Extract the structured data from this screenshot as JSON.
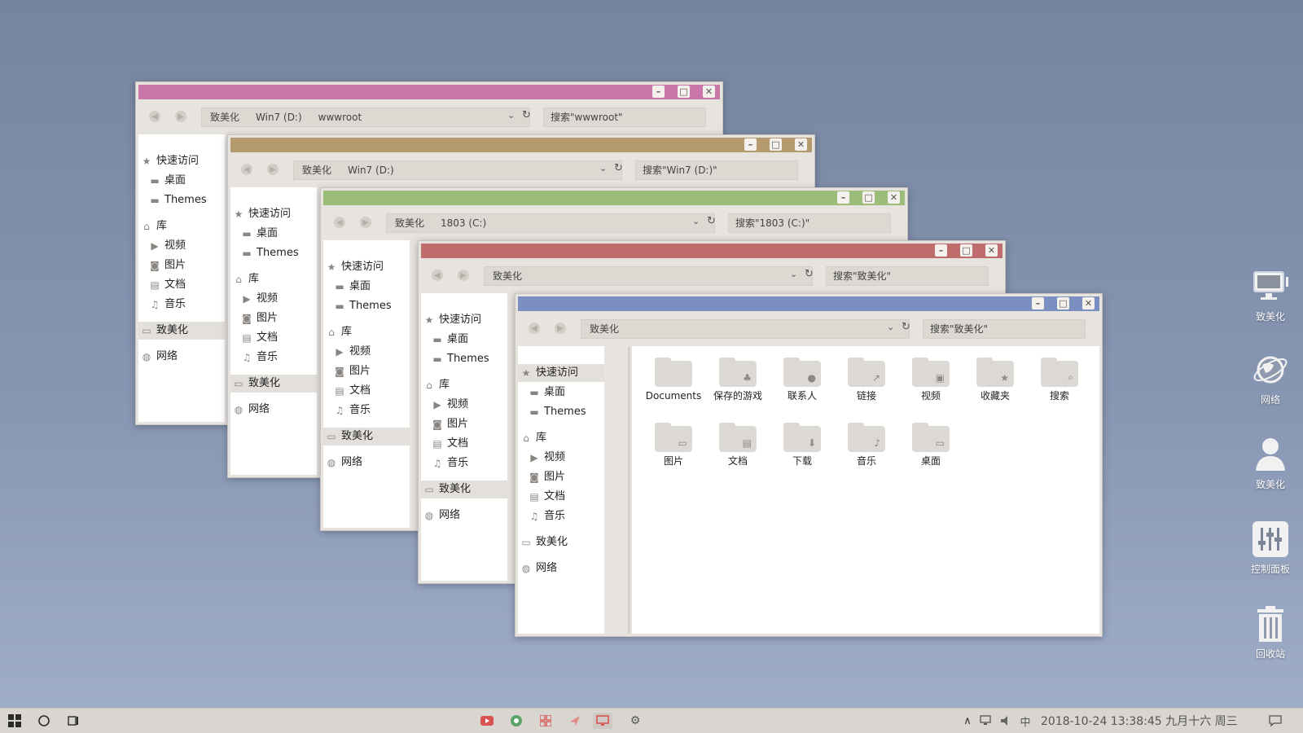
{
  "window_controls": {
    "minimize": "–",
    "maximize": "□",
    "close": "✕"
  },
  "nav": {
    "back": "◀",
    "forward": "▶",
    "dropdown": "⌄",
    "refresh": "↻"
  },
  "windows": [
    {
      "color": "#c877a8",
      "address": [
        "致美化",
        "Win7 (D:)",
        "wwwroot"
      ],
      "search": "搜索\"wwwroot\""
    },
    {
      "color": "#b49a6c",
      "address": [
        "致美化",
        "Win7 (D:)"
      ],
      "search": "搜索\"Win7 (D:)\""
    },
    {
      "color": "#9bbd79",
      "address": [
        "致美化",
        "1803 (C:)"
      ],
      "search": "搜索\"1803 (C:)\""
    },
    {
      "color": "#be6c6e",
      "address": [
        "致美化"
      ],
      "search": "搜索\"致美化\""
    },
    {
      "color": "#7b8fc0",
      "address": [
        "致美化"
      ],
      "search": "搜索\"致美化\""
    }
  ],
  "sidebar": [
    {
      "icon": "★",
      "label": "快速访问",
      "kind": "star"
    },
    {
      "icon": "▬",
      "label": "桌面",
      "kind": "folder"
    },
    {
      "icon": "▬",
      "label": "Themes",
      "kind": "folder"
    },
    {
      "icon": "⌂",
      "label": "库",
      "kind": "library"
    },
    {
      "icon": "▶",
      "label": "视频",
      "kind": "video"
    },
    {
      "icon": "◙",
      "label": "图片",
      "kind": "picture"
    },
    {
      "icon": "▤",
      "label": "文档",
      "kind": "document"
    },
    {
      "icon": "♫",
      "label": "音乐",
      "kind": "music"
    },
    {
      "icon": "▭",
      "label": "致美化",
      "kind": "computer"
    },
    {
      "icon": "◍",
      "label": "网络",
      "kind": "network"
    }
  ],
  "folders": [
    {
      "label": "Documents",
      "emblem": ""
    },
    {
      "label": "保存的游戏",
      "emblem": "♣"
    },
    {
      "label": "联系人",
      "emblem": "●"
    },
    {
      "label": "链接",
      "emblem": "↗"
    },
    {
      "label": "视频",
      "emblem": "▣"
    },
    {
      "label": "收藏夹",
      "emblem": "★"
    },
    {
      "label": "搜索",
      "emblem": "⌕"
    },
    {
      "label": "图片",
      "emblem": "▭"
    },
    {
      "label": "文档",
      "emblem": "▤"
    },
    {
      "label": "下载",
      "emblem": "⬇"
    },
    {
      "label": "音乐",
      "emblem": "♪"
    },
    {
      "label": "桌面",
      "emblem": "▭"
    }
  ],
  "desktop_icons": [
    {
      "label": "致美化",
      "icon": "computer"
    },
    {
      "label": "网络",
      "icon": "network"
    },
    {
      "label": "致美化",
      "icon": "user"
    },
    {
      "label": "控制面板",
      "icon": "control-panel"
    },
    {
      "label": "回收站",
      "icon": "recycle-bin"
    }
  ],
  "taskbar": {
    "clock": "2018-10-24  13:38:45 九月十六 周三",
    "ime": "中",
    "tray_up": "∧"
  }
}
